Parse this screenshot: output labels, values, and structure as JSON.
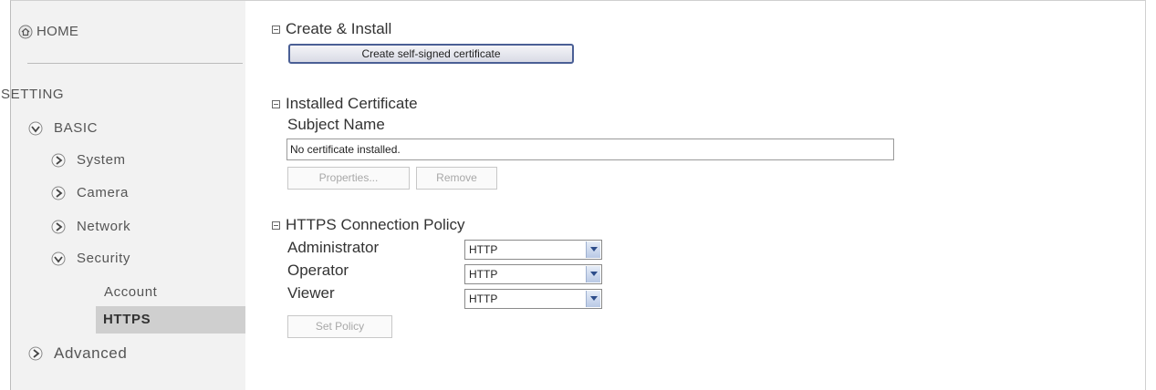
{
  "sidebar": {
    "home_label": "HOME",
    "setting_label": "SETTING",
    "basic_label": "BASIC",
    "items": [
      "System",
      "Camera",
      "Network",
      "Security"
    ],
    "security_sub": [
      "Account",
      "HTTPS"
    ],
    "advanced_label": "Advanced"
  },
  "create_install": {
    "title": "Create & Install",
    "button": "Create self-signed certificate"
  },
  "installed_cert": {
    "title": "Installed Certificate",
    "subject_label": "Subject Name",
    "subject_value": "No certificate installed.",
    "properties_button": "Properties...",
    "remove_button": "Remove"
  },
  "policy": {
    "title": "HTTPS Connection Policy",
    "rows": [
      {
        "label": "Administrator",
        "value": "HTTP"
      },
      {
        "label": "Operator",
        "value": "HTTP"
      },
      {
        "label": "Viewer",
        "value": "HTTP"
      }
    ],
    "set_button": "Set Policy"
  },
  "colors": {
    "sidebar_bg": "#f2f2f2",
    "active_bg": "#cfcfcf",
    "button_border": "#4a5f95"
  }
}
